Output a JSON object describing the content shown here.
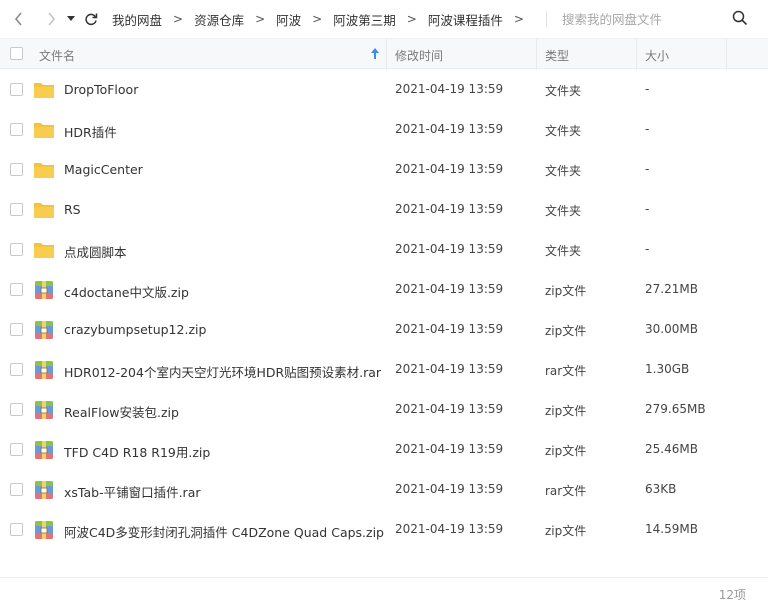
{
  "toolbar": {
    "back_icon": "chevron-left-icon",
    "forward_icon": "chevron-right-icon",
    "dropdown_icon": "caret-down-icon",
    "refresh_icon": "refresh-icon",
    "breadcrumb": [
      "我的网盘",
      "资源仓库",
      "阿波",
      "阿波第三期",
      "阿波课程插件"
    ],
    "separator": ">",
    "search_placeholder": "搜索我的网盘文件"
  },
  "table": {
    "headers": {
      "name": "文件名",
      "modified": "修改时间",
      "type": "类型",
      "size": "大小"
    },
    "sort_icon": "sort-up-arrow-icon",
    "rows": [
      {
        "name": "DropToFloor",
        "date": "2021-04-19 13:59",
        "type": "文件夹",
        "size": "-",
        "icon": "folder-icon"
      },
      {
        "name": "HDR插件",
        "date": "2021-04-19 13:59",
        "type": "文件夹",
        "size": "-",
        "icon": "folder-icon"
      },
      {
        "name": "MagicCenter",
        "date": "2021-04-19 13:59",
        "type": "文件夹",
        "size": "-",
        "icon": "folder-icon"
      },
      {
        "name": "RS",
        "date": "2021-04-19 13:59",
        "type": "文件夹",
        "size": "-",
        "icon": "folder-icon"
      },
      {
        "name": "点成圆脚本",
        "date": "2021-04-19 13:59",
        "type": "文件夹",
        "size": "-",
        "icon": "folder-icon"
      },
      {
        "name": "c4doctane中文版.zip",
        "date": "2021-04-19 13:59",
        "type": "zip文件",
        "size": "27.21MB",
        "icon": "archive-icon"
      },
      {
        "name": "crazybumpsetup12.zip",
        "date": "2021-04-19 13:59",
        "type": "zip文件",
        "size": "30.00MB",
        "icon": "archive-icon"
      },
      {
        "name": "HDR012-204个室内天空灯光环境HDR贴图预设素材.rar",
        "date": "2021-04-19 13:59",
        "type": "rar文件",
        "size": "1.30GB",
        "icon": "archive-icon"
      },
      {
        "name": "RealFlow安装包.zip",
        "date": "2021-04-19 13:59",
        "type": "zip文件",
        "size": "279.65MB",
        "icon": "archive-icon"
      },
      {
        "name": "TFD C4D R18 R19用.zip",
        "date": "2021-04-19 13:59",
        "type": "zip文件",
        "size": "25.46MB",
        "icon": "archive-icon"
      },
      {
        "name": "xsTab-平铺窗口插件.rar",
        "date": "2021-04-19 13:59",
        "type": "rar文件",
        "size": "63KB",
        "icon": "archive-icon"
      },
      {
        "name": "阿波C4D多变形封闭孔洞插件 C4DZone Quad Caps.zip",
        "date": "2021-04-19 13:59",
        "type": "zip文件",
        "size": "14.59MB",
        "icon": "archive-icon"
      }
    ]
  },
  "footer": {
    "count": "12项"
  },
  "colors": {
    "folder": "#f5c33b",
    "archive_body": "#6a9bd8",
    "archive_top": "#8bc34a",
    "archive_bottom": "#e57373",
    "sort_arrow": "#3b8ee8"
  }
}
